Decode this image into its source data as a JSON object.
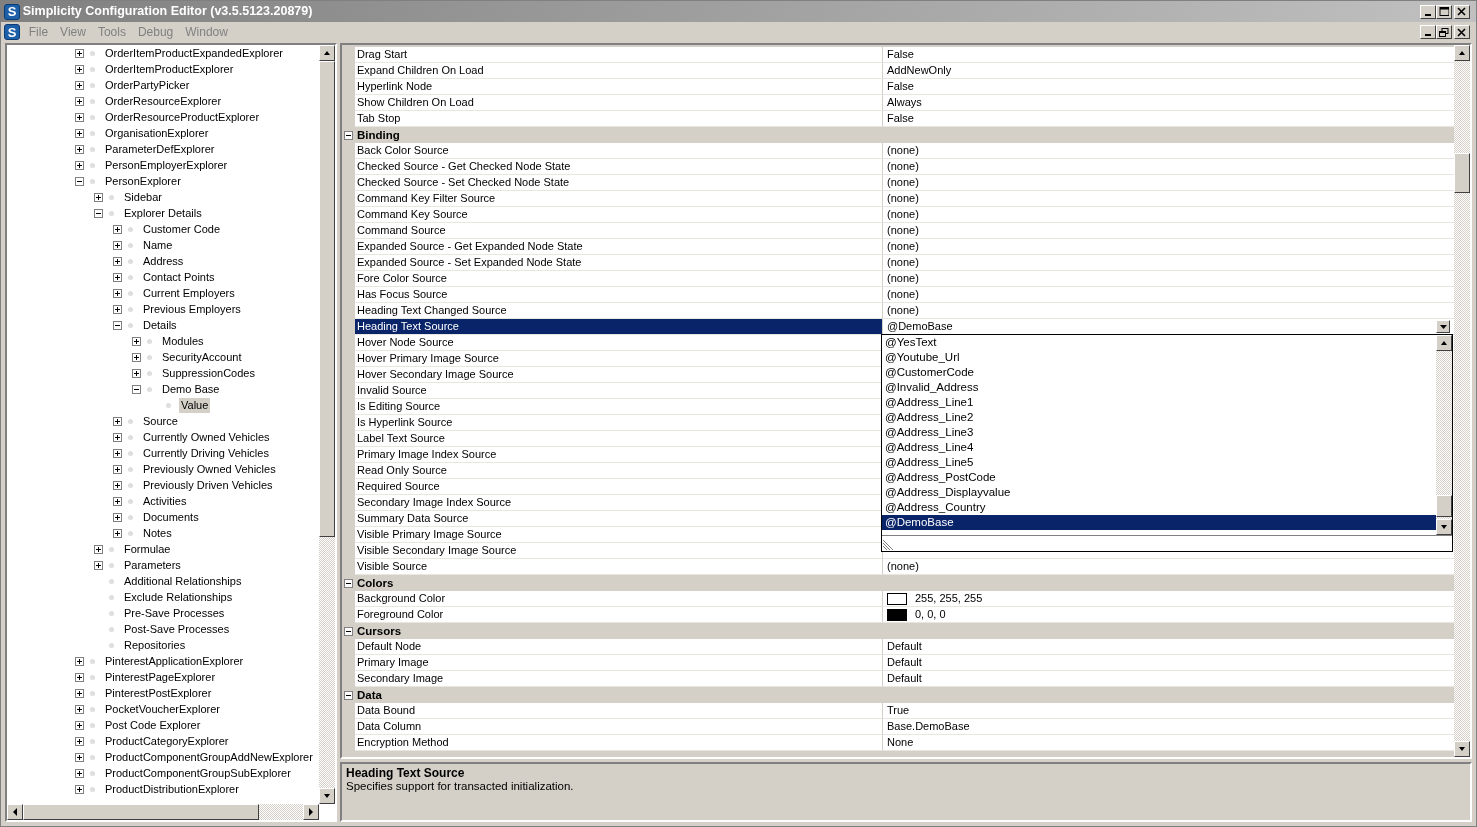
{
  "title_bar": {
    "icon_text": "S",
    "title": "Simplicity Configuration Editor (v3.5.5123.20879)"
  },
  "menu_bar": {
    "icon_text": "S",
    "items": [
      {
        "label": "File",
        "disabled": true
      },
      {
        "label": "View",
        "disabled": true
      },
      {
        "label": "Tools",
        "disabled": true
      },
      {
        "label": "Debug",
        "disabled": true
      },
      {
        "label": "Window",
        "disabled": true
      }
    ]
  },
  "tree": {
    "items": [
      {
        "label": "OrderItemProductExpandedExplorer",
        "expanded": false,
        "selected": false
      },
      {
        "label": "OrderItemProductExplorer",
        "expanded": false,
        "selected": false
      },
      {
        "label": "OrderPartyPicker",
        "expanded": false,
        "selected": false
      },
      {
        "label": "OrderResourceExplorer",
        "expanded": false,
        "selected": false
      },
      {
        "label": "OrderResourceProductExplorer",
        "expanded": false,
        "selected": false
      },
      {
        "label": "OrganisationExplorer",
        "expanded": false,
        "selected": false
      },
      {
        "label": "ParameterDefExplorer",
        "expanded": false,
        "selected": false
      },
      {
        "label": "PersonEmployerExplorer",
        "expanded": false,
        "selected": false
      },
      {
        "label": "PersonExplorer",
        "expanded": true,
        "selected": false,
        "children": [
          {
            "label": "Sidebar",
            "expanded": false,
            "selected": false
          },
          {
            "label": "Explorer Details",
            "expanded": true,
            "selected": false,
            "children": [
              {
                "label": "Customer Code",
                "expanded": false,
                "selected": false
              },
              {
                "label": "Name",
                "expanded": false,
                "selected": false
              },
              {
                "label": "Address",
                "expanded": false,
                "selected": false
              },
              {
                "label": "Contact Points",
                "expanded": false,
                "selected": false
              },
              {
                "label": "Current Employers",
                "expanded": false,
                "selected": false
              },
              {
                "label": "Previous Employers",
                "expanded": false,
                "selected": false
              },
              {
                "label": "Details",
                "expanded": true,
                "selected": false,
                "children": [
                  {
                    "label": "Modules",
                    "expanded": false,
                    "selected": false
                  },
                  {
                    "label": "SecurityAccount",
                    "expanded": false,
                    "selected": false
                  },
                  {
                    "label": "SuppressionCodes",
                    "expanded": false,
                    "selected": false
                  },
                  {
                    "label": "Demo Base",
                    "expanded": true,
                    "selected": false,
                    "children": [
                      {
                        "label": "Value",
                        "selected": true
                      }
                    ]
                  }
                ]
              },
              {
                "label": "Source",
                "expanded": false,
                "selected": false
              },
              {
                "label": "Currently Owned Vehicles",
                "expanded": false,
                "selected": false
              },
              {
                "label": "Currently Driving Vehicles",
                "expanded": false,
                "selected": false
              },
              {
                "label": "Previously Owned Vehicles",
                "expanded": false,
                "selected": false
              },
              {
                "label": "Previously Driven Vehicles",
                "expanded": false,
                "selected": false
              },
              {
                "label": "Activities",
                "expanded": false,
                "selected": false
              },
              {
                "label": "Documents",
                "expanded": false,
                "selected": false
              },
              {
                "label": "Notes",
                "expanded": false,
                "selected": false
              }
            ]
          },
          {
            "label": "Formulae",
            "expanded": false,
            "selected": false
          },
          {
            "label": "Parameters",
            "expanded": false,
            "selected": false
          },
          {
            "label": "Additional Relationships",
            "selected": false
          },
          {
            "label": "Exclude Relationships",
            "selected": false
          },
          {
            "label": "Pre-Save Processes",
            "selected": false
          },
          {
            "label": "Post-Save Processes",
            "selected": false
          },
          {
            "label": "Repositories",
            "selected": false
          }
        ]
      },
      {
        "label": "PinterestApplicationExplorer",
        "expanded": false,
        "selected": false
      },
      {
        "label": "PinterestPageExplorer",
        "expanded": false,
        "selected": false
      },
      {
        "label": "PinterestPostExplorer",
        "expanded": false,
        "selected": false
      },
      {
        "label": "PocketVoucherExplorer",
        "expanded": false,
        "selected": false
      },
      {
        "label": "Post Code Explorer",
        "expanded": false,
        "selected": false
      },
      {
        "label": "ProductCategoryExplorer",
        "expanded": false,
        "selected": false
      },
      {
        "label": "ProductComponentGroupAddNewExplorer",
        "expanded": false,
        "selected": false
      },
      {
        "label": "ProductComponentGroupSubExplorer",
        "expanded": false,
        "selected": false
      },
      {
        "label": "ProductDistributionExplorer",
        "expanded": false,
        "selected": false
      }
    ]
  },
  "property_grid": {
    "rows": [
      {
        "kind": "property",
        "name": "Drag Start",
        "value": "False",
        "selected": false
      },
      {
        "kind": "property",
        "name": "Expand Children On Load",
        "value": "AddNewOnly",
        "selected": false
      },
      {
        "kind": "property",
        "name": "Hyperlink Node",
        "value": "False",
        "selected": false
      },
      {
        "kind": "property",
        "name": "Show Children On Load",
        "value": "Always",
        "selected": false
      },
      {
        "kind": "property",
        "name": "Tab Stop",
        "value": "False",
        "selected": false
      },
      {
        "kind": "category",
        "name": "Binding",
        "expanded": true
      },
      {
        "kind": "property",
        "name": "Back Color Source",
        "value": "(none)",
        "selected": false
      },
      {
        "kind": "property",
        "name": "Checked Source - Get Checked Node State",
        "value": "(none)",
        "selected": false
      },
      {
        "kind": "property",
        "name": "Checked Source - Set Checked Node State",
        "value": "(none)",
        "selected": false
      },
      {
        "kind": "property",
        "name": "Command Key Filter Source",
        "value": "(none)",
        "selected": false
      },
      {
        "kind": "property",
        "name": "Command Key Source",
        "value": "(none)",
        "selected": false
      },
      {
        "kind": "property",
        "name": "Command Source",
        "value": "(none)",
        "selected": false
      },
      {
        "kind": "property",
        "name": "Expanded Source - Get Expanded Node State",
        "value": "(none)",
        "selected": false
      },
      {
        "kind": "property",
        "name": "Expanded Source - Set Expanded Node State",
        "value": "(none)",
        "selected": false
      },
      {
        "kind": "property",
        "name": "Fore Color Source",
        "value": "(none)",
        "selected": false
      },
      {
        "kind": "property",
        "name": "Has Focus Source",
        "value": "(none)",
        "selected": false
      },
      {
        "kind": "property",
        "name": "Heading Text Changed Source",
        "value": "(none)",
        "selected": false
      },
      {
        "kind": "property",
        "name": "Heading Text Source",
        "value": "@DemoBase",
        "selected": true,
        "dropdown": {
          "items": [
            {
              "label": "@YesText",
              "selected": false
            },
            {
              "label": "@Youtube_Url",
              "selected": false
            },
            {
              "label": "@CustomerCode",
              "selected": false
            },
            {
              "label": "@Invalid_Address",
              "selected": false
            },
            {
              "label": "@Address_Line1",
              "selected": false
            },
            {
              "label": "@Address_Line2",
              "selected": false
            },
            {
              "label": "@Address_Line3",
              "selected": false
            },
            {
              "label": "@Address_Line4",
              "selected": false
            },
            {
              "label": "@Address_Line5",
              "selected": false
            },
            {
              "label": "@Address_PostCode",
              "selected": false
            },
            {
              "label": "@Address_Displayvalue",
              "selected": false
            },
            {
              "label": "@Address_Country",
              "selected": false
            },
            {
              "label": "@DemoBase",
              "selected": true
            }
          ]
        }
      },
      {
        "kind": "property",
        "name": "Hover Node Source",
        "selected": false
      },
      {
        "kind": "property",
        "name": "Hover Primary Image Source",
        "selected": false
      },
      {
        "kind": "property",
        "name": "Hover Secondary Image Source",
        "selected": false
      },
      {
        "kind": "property",
        "name": "Invalid Source",
        "selected": false
      },
      {
        "kind": "property",
        "name": "Is Editing Source",
        "selected": false
      },
      {
        "kind": "property",
        "name": "Is Hyperlink Source",
        "selected": false
      },
      {
        "kind": "property",
        "name": "Label Text Source",
        "selected": false
      },
      {
        "kind": "property",
        "name": "Primary Image Index Source",
        "selected": false
      },
      {
        "kind": "property",
        "name": "Read Only Source",
        "selected": false
      },
      {
        "kind": "property",
        "name": "Required Source",
        "selected": false
      },
      {
        "kind": "property",
        "name": "Secondary Image Index Source",
        "selected": false
      },
      {
        "kind": "property",
        "name": "Summary Data Source",
        "selected": false
      },
      {
        "kind": "property",
        "name": "Visible Primary Image Source",
        "selected": false
      },
      {
        "kind": "property",
        "name": "Visible Secondary Image Source",
        "selected": false
      },
      {
        "kind": "property",
        "name": "Visible Source",
        "value": "(none)",
        "selected": false
      },
      {
        "kind": "category",
        "name": "Colors",
        "expanded": true
      },
      {
        "kind": "property",
        "name": "Background Color",
        "value": "255, 255, 255",
        "color": "#ffffff",
        "selected": false
      },
      {
        "kind": "property",
        "name": "Foreground Color",
        "value": "0, 0, 0",
        "color": "#000000",
        "selected": false
      },
      {
        "kind": "category",
        "name": "Cursors",
        "expanded": true
      },
      {
        "kind": "property",
        "name": "Default Node",
        "value": "Default",
        "selected": false
      },
      {
        "kind": "property",
        "name": "Primary Image",
        "value": "Default",
        "selected": false
      },
      {
        "kind": "property",
        "name": "Secondary Image",
        "value": "Default",
        "selected": false
      },
      {
        "kind": "category",
        "name": "Data",
        "expanded": true
      },
      {
        "kind": "property",
        "name": "Data Bound",
        "value": "True",
        "selected": false
      },
      {
        "kind": "property",
        "name": "Data Column",
        "value": "Base.DemoBase",
        "selected": false
      },
      {
        "kind": "property",
        "name": "Encryption Method",
        "value": "None",
        "selected": false
      }
    ]
  },
  "help_panel": {
    "title": "Heading Text Source",
    "description": "Specifies support for transacted initialization."
  }
}
